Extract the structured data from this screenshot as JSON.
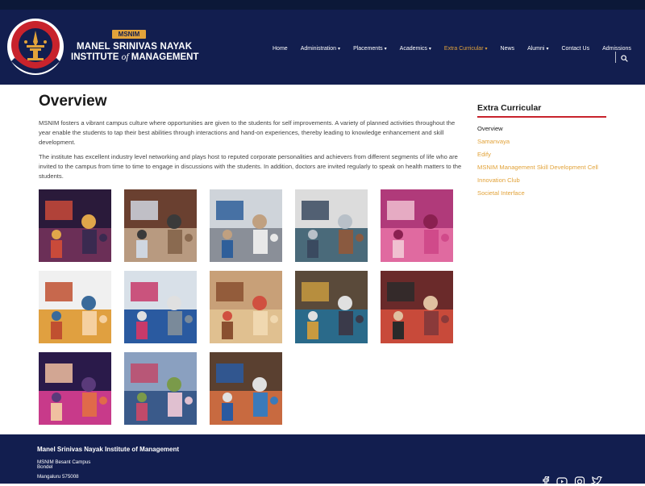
{
  "header": {
    "logo": {
      "badge": "MSNIM",
      "name_line1": "MANEL SRINIVAS NAYAK",
      "name_line2_pre": "INSTITUTE ",
      "name_line2_italic": "of",
      "name_line2_post": " MANAGEMENT",
      "emblem_text": "BESANT INSTITUTIONS · SINCE 1918"
    },
    "nav": [
      {
        "label": "Home",
        "dropdown": false,
        "active": false
      },
      {
        "label": "Administration",
        "dropdown": true,
        "active": false
      },
      {
        "label": "Placements",
        "dropdown": true,
        "active": false
      },
      {
        "label": "Academics",
        "dropdown": true,
        "active": false
      },
      {
        "label": "Extra Curricular",
        "dropdown": true,
        "active": true
      },
      {
        "label": "News",
        "dropdown": false,
        "active": false
      },
      {
        "label": "Alumni",
        "dropdown": true,
        "active": false
      },
      {
        "label": "Contact Us",
        "dropdown": false,
        "active": false
      },
      {
        "label": "Admissions",
        "dropdown": false,
        "active": false
      }
    ],
    "search_icon": "search-icon"
  },
  "main": {
    "title": "Overview",
    "paragraphs": [
      "MSNIM fosters a vibrant campus culture where opportunities are given to the students for self improvements. A variety of planned activities throughout the year enable the students to tap their best abilities through interactions and hand-on experiences, thereby leading to knowledge enhancement and skill development.",
      "The institute has excellent industry level networking and plays host to reputed corporate personalities and achievers from different segments of life who are invited to the campus from time to time to engage in discussions with the students. In addition, doctors are invited regularly to speak on health matters to the students."
    ],
    "gallery_count": 13
  },
  "sidebar": {
    "title": "Extra Curricular",
    "items": [
      {
        "label": "Overview",
        "current": true
      },
      {
        "label": "Samanvaya",
        "current": false
      },
      {
        "label": "Edify",
        "current": false
      },
      {
        "label": "MSNIM Management Skill Development Cell",
        "current": false
      },
      {
        "label": "Innovation Club",
        "current": false
      },
      {
        "label": "Societal Interface",
        "current": false
      }
    ]
  },
  "footer": {
    "title": "Manel Srinivas Nayak Institute of Management",
    "address_line1": "MSNIM Besant Campus",
    "address_line2": "Bondel",
    "address_line3": "Mangaluru 575008",
    "social_icons": [
      "facebook-icon",
      "youtube-icon",
      "instagram-icon",
      "twitter-icon"
    ]
  },
  "colors": {
    "header_bg": "#121e4f",
    "accent": "#e2a33a",
    "sidebar_rule": "#c8232c"
  }
}
